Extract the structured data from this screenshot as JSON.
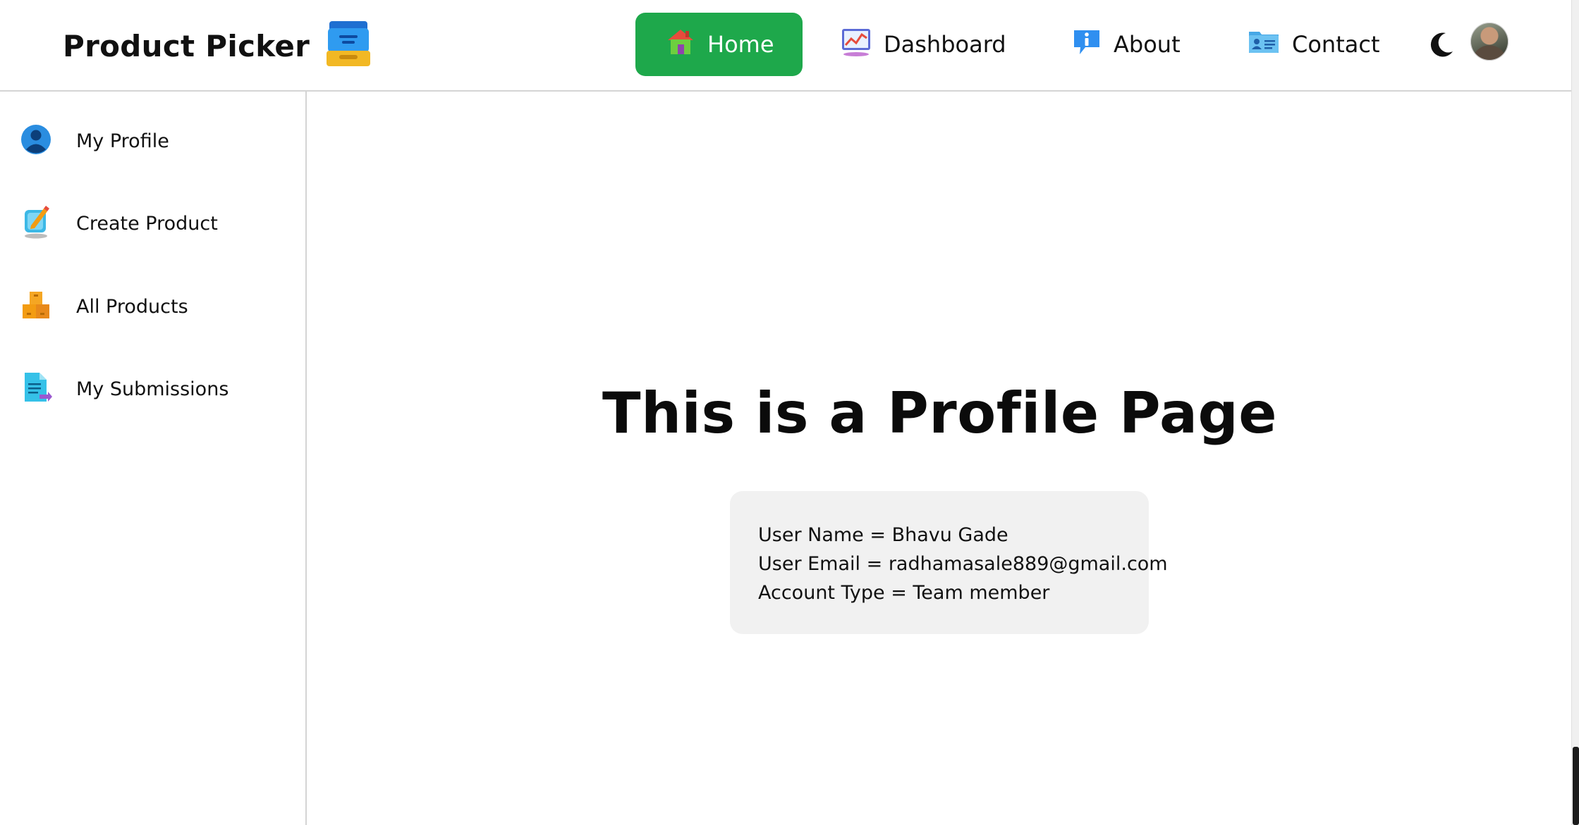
{
  "brand": {
    "title": "Product Picker",
    "icon": "file-cabinet-icon"
  },
  "nav": {
    "items": [
      {
        "label": "Home",
        "icon": "house-icon",
        "active": true
      },
      {
        "label": "Dashboard",
        "icon": "chart-icon",
        "active": false
      },
      {
        "label": "About",
        "icon": "info-icon",
        "active": false
      },
      {
        "label": "Contact",
        "icon": "contact-card-icon",
        "active": false
      }
    ],
    "theme_toggle_icon": "moon-icon",
    "accent_color": "#1ea84b"
  },
  "sidebar": {
    "items": [
      {
        "label": "My Profile",
        "icon": "user-icon"
      },
      {
        "label": "Create Product",
        "icon": "edit-pencil-icon"
      },
      {
        "label": "All Products",
        "icon": "boxes-icon"
      },
      {
        "label": "My Submissions",
        "icon": "document-icon"
      }
    ]
  },
  "main": {
    "title": "This is a Profile Page",
    "profile": {
      "user_name": "User Name = Bhavu Gade",
      "user_email": "User Email = radhamasale889@gmail.com",
      "account_type": "Account Type = Team member"
    }
  }
}
